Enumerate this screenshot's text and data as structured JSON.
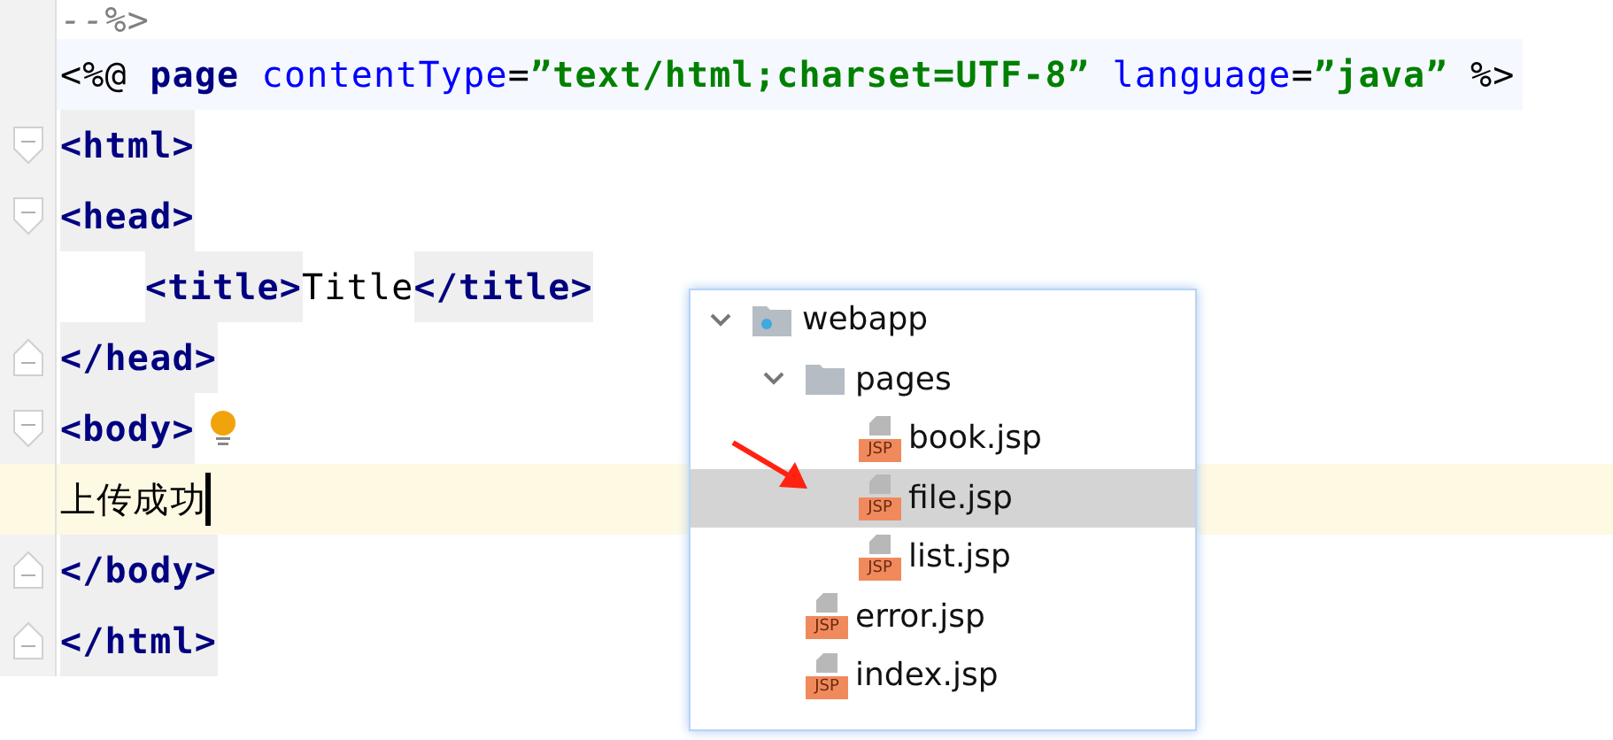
{
  "editor": {
    "lines": [
      {
        "current": false,
        "tokens": [
          {
            "kind": "comment",
            "text": "--%>"
          }
        ]
      },
      {
        "current": false,
        "directive": true,
        "tokens": [
          {
            "kind": "text",
            "text": "<%@ "
          },
          {
            "kind": "keyword",
            "text": "page "
          },
          {
            "kind": "attr",
            "text": "contentType"
          },
          {
            "kind": "text",
            "text": "="
          },
          {
            "kind": "string",
            "text": "”text/html;charset=UTF-8” "
          },
          {
            "kind": "attr",
            "text": "language"
          },
          {
            "kind": "text",
            "text": "="
          },
          {
            "kind": "string",
            "text": "”java” "
          },
          {
            "kind": "text",
            "text": "%>"
          }
        ]
      },
      {
        "fold_open": true,
        "current": false,
        "tokens": [
          {
            "kind": "tag",
            "text": "<html>"
          }
        ]
      },
      {
        "fold_open": true,
        "current": false,
        "tokens": [
          {
            "kind": "tag",
            "text": "<head>"
          }
        ]
      },
      {
        "current": false,
        "indented": true,
        "tokens": [
          {
            "kind": "tag",
            "text": "<title>"
          },
          {
            "kind": "text",
            "text": "Title"
          },
          {
            "kind": "tag",
            "text": "</title>"
          }
        ]
      },
      {
        "fold_close": true,
        "current": false,
        "tokens": [
          {
            "kind": "tag",
            "text": "</head>"
          }
        ]
      },
      {
        "fold_open": true,
        "current": false,
        "bulb": true,
        "tokens": [
          {
            "kind": "tag",
            "text": "<body>"
          }
        ]
      },
      {
        "current": true,
        "tokens": [
          {
            "kind": "text",
            "text": "上传成功"
          }
        ]
      },
      {
        "fold_close": true,
        "current": false,
        "tokens": [
          {
            "kind": "tag",
            "text": "</body>"
          }
        ]
      },
      {
        "fold_close": true,
        "current": false,
        "tokens": [
          {
            "kind": "tag",
            "text": "</html>"
          }
        ]
      }
    ]
  },
  "project_tree": [
    {
      "name": "webapp",
      "kind": "module",
      "expanded": true,
      "selected": false,
      "children": [
        {
          "name": "pages",
          "kind": "folder",
          "expanded": true,
          "selected": false,
          "children": [
            {
              "name": "book.jsp",
              "kind": "jsp",
              "icon_label": "JSP",
              "selected": false
            },
            {
              "name": "file.jsp",
              "kind": "jsp",
              "icon_label": "JSP",
              "selected": true
            },
            {
              "name": "list.jsp",
              "kind": "jsp",
              "icon_label": "JSP",
              "selected": false
            }
          ]
        },
        {
          "name": "error.jsp",
          "kind": "jsp",
          "icon_label": "JSP",
          "selected": false
        },
        {
          "name": "index.jsp",
          "kind": "jsp",
          "icon_label": "JSP",
          "selected": false
        }
      ]
    }
  ]
}
